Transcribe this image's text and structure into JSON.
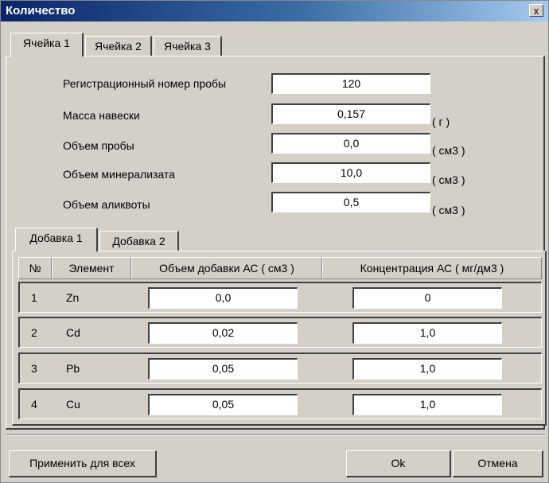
{
  "window": {
    "title": "Количество",
    "close_symbol": "x"
  },
  "top_tabs": [
    "Ячейка 1",
    "Ячейка 2",
    "Ячейка 3"
  ],
  "fields": [
    {
      "label": "Регистрационный номер пробы",
      "value": "120",
      "unit": ""
    },
    {
      "label": "Масса навески",
      "value": "0,157",
      "unit": "( г )"
    },
    {
      "label": "Объем пробы",
      "value": "0,0",
      "unit": "( см3 )"
    },
    {
      "label": "Объем минерализата",
      "value": "10,0",
      "unit": "( см3 )"
    },
    {
      "label": "Объем аликвоты",
      "value": "0,5",
      "unit": "( см3 )"
    }
  ],
  "sub_tabs": [
    "Добавка 1",
    "Добавка 2"
  ],
  "table": {
    "headers": [
      "№",
      "Элемент",
      "Объем добавки АС ( см3 )",
      "Концентрация АС ( мг/дм3 )"
    ],
    "rows": [
      {
        "n": "1",
        "element": "Zn",
        "volume": "0,0",
        "conc": "0"
      },
      {
        "n": "2",
        "element": "Cd",
        "volume": "0,02",
        "conc": "1,0"
      },
      {
        "n": "3",
        "element": "Pb",
        "volume": "0,05",
        "conc": "1,0"
      },
      {
        "n": "4",
        "element": "Cu",
        "volume": "0,05",
        "conc": "1,0"
      }
    ]
  },
  "buttons": {
    "apply_all": "Применить для всех",
    "ok": "Ok",
    "cancel": "Отмена"
  }
}
